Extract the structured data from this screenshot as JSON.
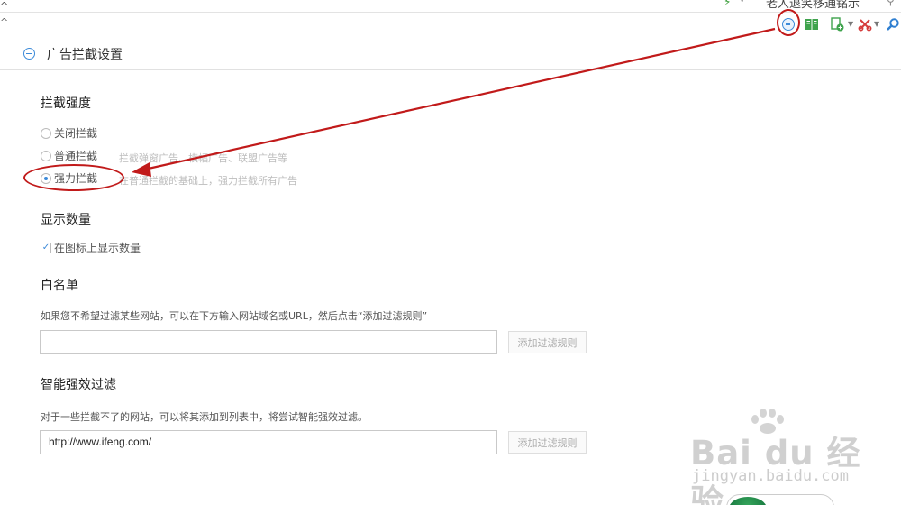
{
  "browser": {
    "hint_text": "老人退笑移通铭示"
  },
  "toolbar": {
    "icons": [
      "adblock-icon",
      "reading-book-icon",
      "add-page-icon",
      "scissors-icon",
      "search-icon"
    ]
  },
  "header": {
    "title": "广告拦截设置"
  },
  "intensity": {
    "title": "拦截强度",
    "options": [
      {
        "label": "关闭拦截",
        "desc": "",
        "selected": false
      },
      {
        "label": "普通拦截",
        "desc": "拦截弹窗广告、横幅广告、联盟广告等",
        "selected": false
      },
      {
        "label": "强力拦截",
        "desc": "在普通拦截的基础上，强力拦截所有广告",
        "selected": true
      }
    ]
  },
  "count": {
    "title": "显示数量",
    "checkbox_label": "在图标上显示数量",
    "checked": true
  },
  "whitelist": {
    "title": "白名单",
    "description": "如果您不希望过滤某些网站，可以在下方输入网站域名或URL，然后点击“添加过滤规则”",
    "input_value": "",
    "button_label": "添加过滤规则"
  },
  "smart": {
    "title": "智能强效过滤",
    "description": "对于一些拦截不了的网站，可以将其添加到列表中，将尝试智能强效过滤。",
    "input_value": "http://www.ifeng.com/",
    "button_label": "添加过滤规则"
  },
  "watermark": {
    "brand": "Bai du 经验",
    "url": "jingyan.baidu.com"
  },
  "annotation_color": "#c11a1a",
  "accent_color": "#3b8ad9"
}
